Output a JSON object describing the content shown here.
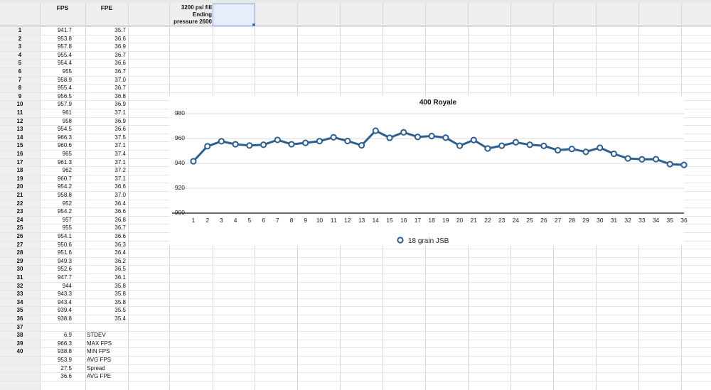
{
  "columns": {
    "fps_header": "FPS",
    "fpe_header": "FPE"
  },
  "note": {
    "line1": "3200 psi fill",
    "line2": "Ending",
    "line3": "pressure 2600"
  },
  "rows": [
    {
      "n": "1",
      "fps": "941.7",
      "fpe": "35.7"
    },
    {
      "n": "2",
      "fps": "953.8",
      "fpe": "36.6"
    },
    {
      "n": "3",
      "fps": "957.8",
      "fpe": "36.9"
    },
    {
      "n": "4",
      "fps": "955.4",
      "fpe": "36.7"
    },
    {
      "n": "5",
      "fps": "954.4",
      "fpe": "36.6"
    },
    {
      "n": "6",
      "fps": "955",
      "fpe": "36.7"
    },
    {
      "n": "7",
      "fps": "958.9",
      "fpe": "37.0"
    },
    {
      "n": "8",
      "fps": "955.4",
      "fpe": "36.7"
    },
    {
      "n": "9",
      "fps": "956.5",
      "fpe": "36.8"
    },
    {
      "n": "10",
      "fps": "957.9",
      "fpe": "36.9"
    },
    {
      "n": "11",
      "fps": "961",
      "fpe": "37.1"
    },
    {
      "n": "12",
      "fps": "958",
      "fpe": "36.9"
    },
    {
      "n": "13",
      "fps": "954.5",
      "fpe": "36.6"
    },
    {
      "n": "14",
      "fps": "966.3",
      "fpe": "37.5"
    },
    {
      "n": "15",
      "fps": "960.6",
      "fpe": "37.1"
    },
    {
      "n": "16",
      "fps": "965",
      "fpe": "37.4"
    },
    {
      "n": "17",
      "fps": "961.3",
      "fpe": "37.1"
    },
    {
      "n": "18",
      "fps": "962",
      "fpe": "37.2"
    },
    {
      "n": "19",
      "fps": "960.7",
      "fpe": "37.1"
    },
    {
      "n": "20",
      "fps": "954.2",
      "fpe": "36.6"
    },
    {
      "n": "21",
      "fps": "958.8",
      "fpe": "37.0"
    },
    {
      "n": "22",
      "fps": "952",
      "fpe": "36.4"
    },
    {
      "n": "23",
      "fps": "954.2",
      "fpe": "36.6"
    },
    {
      "n": "24",
      "fps": "957",
      "fpe": "36.8"
    },
    {
      "n": "25",
      "fps": "955",
      "fpe": "36.7"
    },
    {
      "n": "26",
      "fps": "954.1",
      "fpe": "36.6"
    },
    {
      "n": "27",
      "fps": "950.6",
      "fpe": "36.3"
    },
    {
      "n": "28",
      "fps": "951.6",
      "fpe": "36.4"
    },
    {
      "n": "29",
      "fps": "949.3",
      "fpe": "36.2"
    },
    {
      "n": "30",
      "fps": "952.6",
      "fpe": "36.5"
    },
    {
      "n": "31",
      "fps": "947.7",
      "fpe": "36.1"
    },
    {
      "n": "32",
      "fps": "944",
      "fpe": "35.8"
    },
    {
      "n": "33",
      "fps": "943.3",
      "fpe": "35.8"
    },
    {
      "n": "34",
      "fps": "943.4",
      "fpe": "35.8"
    },
    {
      "n": "35",
      "fps": "939.4",
      "fpe": "35.5"
    },
    {
      "n": "36",
      "fps": "938.8",
      "fpe": "35.4"
    },
    {
      "n": "37",
      "fps": "",
      "fpe": "",
      "label": ""
    },
    {
      "n": "38",
      "fps": "6.9",
      "fpe": "",
      "label": "STDEV"
    },
    {
      "n": "39",
      "fps": "966.3",
      "fpe": "",
      "label": "MAX FPS"
    },
    {
      "n": "40",
      "fps": "938.8",
      "fpe": "",
      "label": "MIN FPS"
    },
    {
      "n": "",
      "fps": "953.9",
      "fpe": "",
      "label": "AVG FPS"
    },
    {
      "n": "",
      "fps": "27.5",
      "fpe": "",
      "label": "Spread"
    },
    {
      "n": "",
      "fps": "36.6",
      "fpe": "",
      "label": "AVG FPE"
    }
  ],
  "chart_data": {
    "type": "line",
    "title": "400 Royale",
    "x": [
      1,
      2,
      3,
      4,
      5,
      6,
      7,
      8,
      9,
      10,
      11,
      12,
      13,
      14,
      15,
      16,
      17,
      18,
      19,
      20,
      21,
      22,
      23,
      24,
      25,
      26,
      27,
      28,
      29,
      30,
      31,
      32,
      33,
      34,
      35,
      36
    ],
    "series": [
      {
        "name": "18 grain JSB",
        "values": [
          941.7,
          953.8,
          957.8,
          955.4,
          954.4,
          955,
          958.9,
          955.4,
          956.5,
          957.9,
          961,
          958,
          954.5,
          966.3,
          960.6,
          965,
          961.3,
          962,
          960.7,
          954.2,
          958.8,
          952,
          954.2,
          957,
          955,
          954.1,
          950.6,
          951.6,
          949.3,
          952.6,
          947.7,
          944,
          943.3,
          943.4,
          939.4,
          938.8
        ]
      }
    ],
    "yticks": [
      900,
      920,
      940,
      960,
      980
    ],
    "ylim": [
      900,
      980
    ],
    "xlabel": "",
    "ylabel": "",
    "grid": true,
    "legend": "bottom",
    "line_color": "#2d5e8e"
  }
}
